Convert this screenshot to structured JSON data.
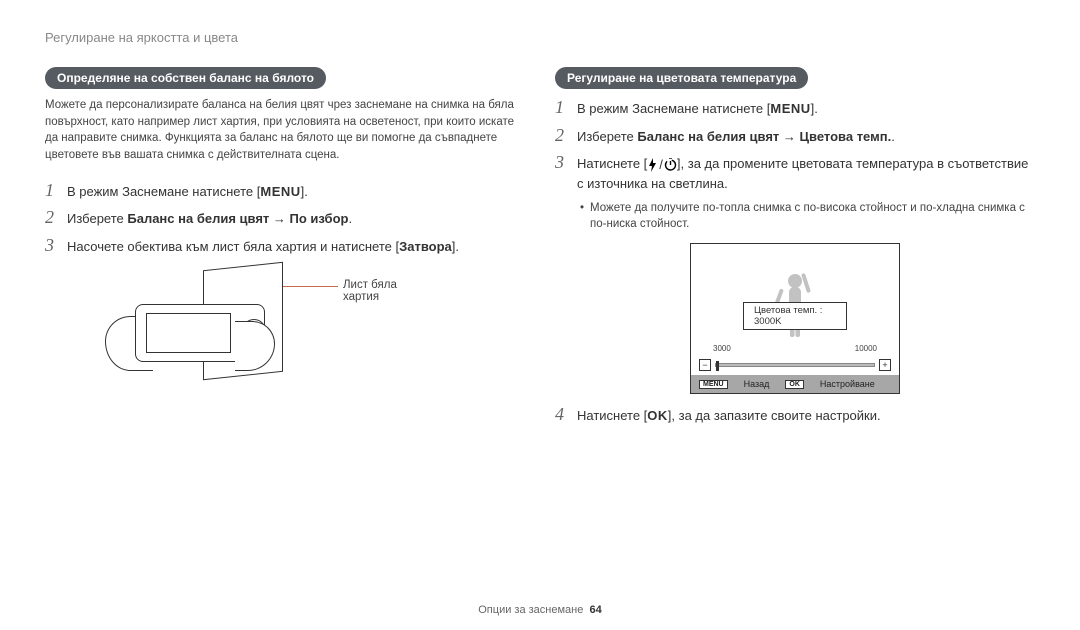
{
  "header": "Регулиране на яркостта и цвета",
  "left": {
    "section_title": "Определяне на собствен баланс на бялото",
    "intro": "Можете да персонализирате баланса на белия цвят чрез заснемане на снимка на бяла повърхност, като например лист хартия, при условията на осветеност, при които искате да направите снимка. Функцията за баланс на бялото ще ви помогне да съвпаднете цветовете във вашата снимка с действителната сцена.",
    "step1_pre": "В режим Заснемане натиснете [",
    "step1_btn": "MENU",
    "step1_post": "].",
    "step2_pre": "Изберете ",
    "step2_bold": "Баланс на белия цвят → По избор",
    "step2_post": ".",
    "step3_pre": "Насочете обектива към лист бяла хартия и натиснете [",
    "step3_bold": "Затвора",
    "step3_post": "].",
    "callout": "Лист бяла хартия"
  },
  "right": {
    "section_title": "Регулиране на цветовата температура",
    "step1_pre": "В режим Заснемане натиснете [",
    "step1_btn": "MENU",
    "step1_post": "].",
    "step2_pre": "Изберете ",
    "step2_bold": "Баланс на белия цвят → Цветова темп.",
    "step2_post": ".",
    "step3_pre": "Натиснете [",
    "step3_post": "], за да промените цветовата температура в съответствие с източника на светлина.",
    "step3_bullet": "Можете да получите по-топла снимка с по-висока стойност и по-хладна снимка с по-ниска стойност.",
    "diagram": {
      "temp_label": "Цветова темп. : 3000K",
      "min": "3000",
      "max": "10000",
      "footer_menu_chip": "MENU",
      "footer_back": "Назад",
      "footer_ok_chip": "OK",
      "footer_set": "Настройване"
    },
    "step4_pre": "Натиснете [",
    "step4_btn": "OK",
    "step4_post": "], за да запазите своите настройки."
  },
  "footer": {
    "section": "Опции за заснемане",
    "page": "64"
  },
  "chart_data": {
    "type": "table",
    "description": "Color temperature slider",
    "range": [
      3000,
      10000
    ],
    "value": 3000,
    "unit": "K",
    "label": "Цветова темп."
  }
}
